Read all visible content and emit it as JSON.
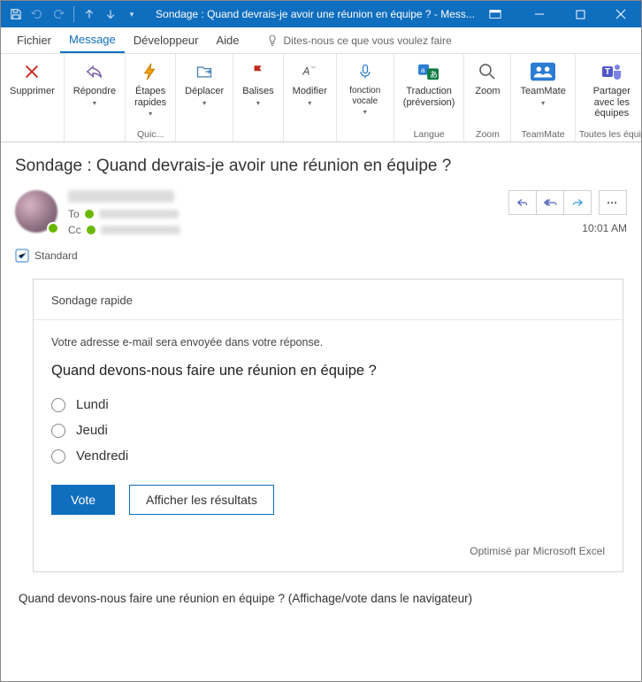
{
  "window": {
    "title": "Sondage : Quand devrais-je avoir une réunion en équipe ? - Mess..."
  },
  "tabs": {
    "file": "Fichier",
    "message": "Message",
    "developer": "Développeur",
    "help": "Aide",
    "tellme": "Dites-nous ce que vous voulez faire"
  },
  "ribbon": {
    "delete": "Supprimer",
    "reply": "Répondre",
    "quicksteps": "Étapes rapides",
    "quicksteps_group": "Quic...",
    "move": "Déplacer",
    "tags": "Balises",
    "modify": "Modifier",
    "voice": "fonction vocale",
    "translate": "Traduction (préversion)",
    "language_group": "Langue",
    "zoom": "Zoom",
    "zoom_group": "Zoom",
    "teammate": "TeamMate",
    "teammate_group": "TeamMate",
    "share_teams": "Partager avec les équipes",
    "all_teams": "Toutes les équipes"
  },
  "message": {
    "subject": "Sondage : Quand devrais-je avoir une réunion en équipe ?",
    "to_label": "To",
    "cc_label": "Cc",
    "time": "10:01 AM",
    "sensitivity": "Standard"
  },
  "poll": {
    "header": "Sondage rapide",
    "disclaimer": "Votre adresse e-mail sera envoyée dans votre réponse.",
    "question": "Quand devons-nous faire une réunion en équipe ?",
    "options": [
      "Lundi",
      "Jeudi",
      "Vendredi"
    ],
    "vote": "Vote",
    "show_results": "Afficher les résultats",
    "powered": "Optimisé par Microsoft Excel"
  },
  "footer": {
    "text": "Quand devons-nous faire une réunion en équipe ? (Affichage/vote dans le navigateur)"
  }
}
